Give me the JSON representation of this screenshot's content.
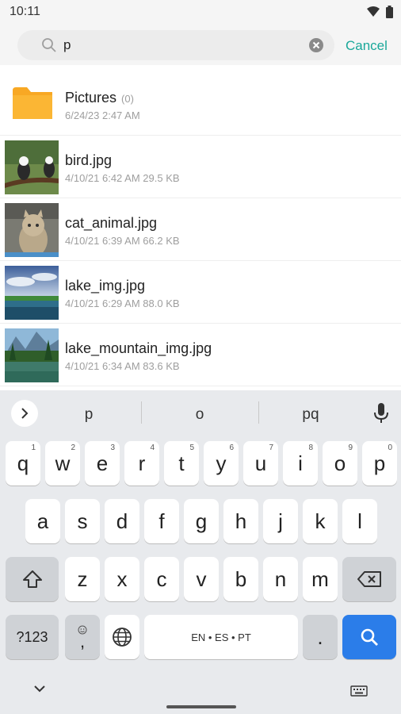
{
  "status": {
    "time": "10:11"
  },
  "search": {
    "value": "p",
    "cancel_label": "Cancel"
  },
  "items": [
    {
      "name": "Pictures",
      "count": "(0)",
      "meta": "6/24/23 2:47 AM",
      "type": "folder"
    },
    {
      "name": "bird.jpg",
      "meta": "4/10/21 6:42 AM 29.5 KB",
      "type": "image"
    },
    {
      "name": "cat_animal.jpg",
      "meta": "4/10/21 6:39 AM 66.2 KB",
      "type": "image"
    },
    {
      "name": "lake_img.jpg",
      "meta": "4/10/21 6:29 AM 88.0 KB",
      "type": "image"
    },
    {
      "name": "lake_mountain_img.jpg",
      "meta": "4/10/21 6:34 AM 83.6 KB",
      "type": "image"
    }
  ],
  "keyboard": {
    "suggestions": [
      "p",
      "o",
      "pq"
    ],
    "row1": [
      "q",
      "w",
      "e",
      "r",
      "t",
      "y",
      "u",
      "i",
      "o",
      "p"
    ],
    "row1_hints": [
      "1",
      "2",
      "3",
      "4",
      "5",
      "6",
      "7",
      "8",
      "9",
      "0"
    ],
    "row2": [
      "a",
      "s",
      "d",
      "f",
      "g",
      "h",
      "j",
      "k",
      "l"
    ],
    "row3": [
      "z",
      "x",
      "c",
      "v",
      "b",
      "n",
      "m"
    ],
    "symbols_label": "?123",
    "comma_label": ",",
    "space_label": "EN • ES • PT",
    "period_label": "."
  },
  "colors": {
    "accent": "#1aa89a",
    "folder": "#f8a824",
    "enter_key": "#2b7de9"
  }
}
